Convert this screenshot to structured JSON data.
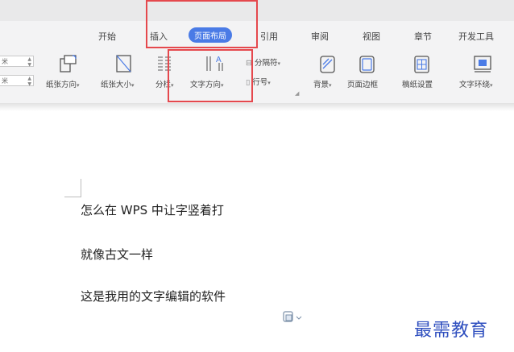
{
  "tabs": [
    {
      "label": "开始",
      "active": false
    },
    {
      "label": "插入",
      "active": false
    },
    {
      "label": "页面布局",
      "active": true
    },
    {
      "label": "引用",
      "active": false
    },
    {
      "label": "审阅",
      "active": false
    },
    {
      "label": "视图",
      "active": false
    },
    {
      "label": "章节",
      "active": false
    },
    {
      "label": "开发工具",
      "active": false
    }
  ],
  "ribbon": {
    "margin_top_unit": "米",
    "margin_bottom_unit": "米",
    "orientation": "纸张方向",
    "size": "纸张大小",
    "columns": "分栏",
    "text_direction": "文字方向",
    "breaks": "分隔符",
    "line_numbers": "行号",
    "background": "背景",
    "page_border": "页面边框",
    "manuscript": "稿纸设置",
    "text_wrap": "文字环绕"
  },
  "document": {
    "lines": [
      "怎么在 WPS 中让字竖着打",
      "就像古文一样",
      "这是我用的文字编辑的软件"
    ]
  },
  "watermark": "最需教育",
  "colors": {
    "accent": "#4a7be6",
    "highlight": "#e5484d",
    "watermark": "#2f4fbf"
  }
}
